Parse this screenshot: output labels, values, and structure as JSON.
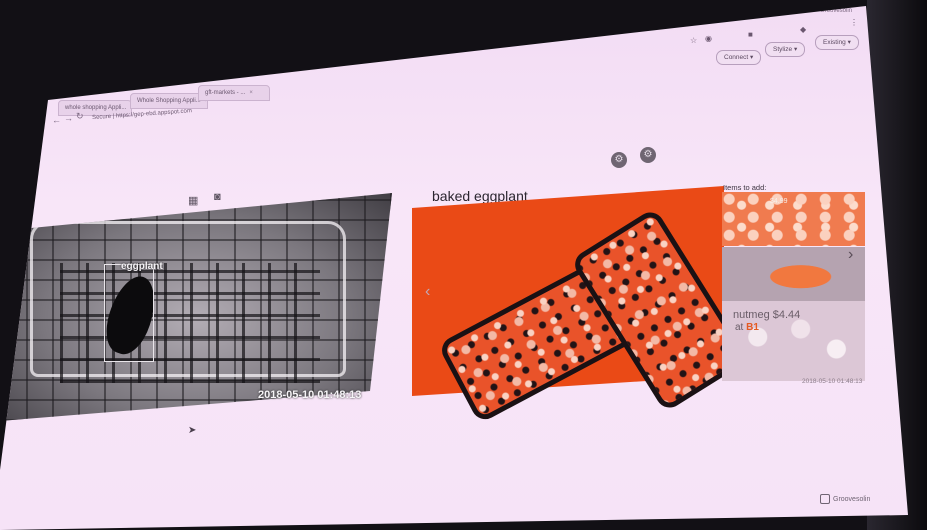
{
  "browser": {
    "tabs": [
      {
        "title": "whole shopping Appli..."
      },
      {
        "title": "Whole Shopping Appli..."
      },
      {
        "title": "gft-markets - ..."
      }
    ],
    "address": "Secure | https://gep-ebd.appspot.com",
    "profile": "Groovesolin"
  },
  "toolbar": {
    "buttons": [
      {
        "label": "Connect"
      },
      {
        "label": "Stylize"
      },
      {
        "label": "Existing"
      }
    ]
  },
  "camera_panel": {
    "detection_label": "eggplant",
    "timestamp": "2018-05-10 01:48:13"
  },
  "recipe_panel": {
    "title": "baked eggplant"
  },
  "items_panel": {
    "header": "Items to add:",
    "top_price": "$4.99",
    "item_name": "nutmeg $4.44",
    "item_store_prefix": "at ",
    "item_store": "B1",
    "timestamp": "2018-05-10 01:48:13"
  },
  "watermark": "Groovesolin",
  "icons": [
    "back-arrow-icon",
    "forward-arrow-icon",
    "reload-icon",
    "star-icon",
    "gear-icon",
    "settings-icon",
    "camera-icon",
    "grid-icon",
    "chevron-right-icon",
    "chevron-left-icon",
    "cursor-icon"
  ]
}
